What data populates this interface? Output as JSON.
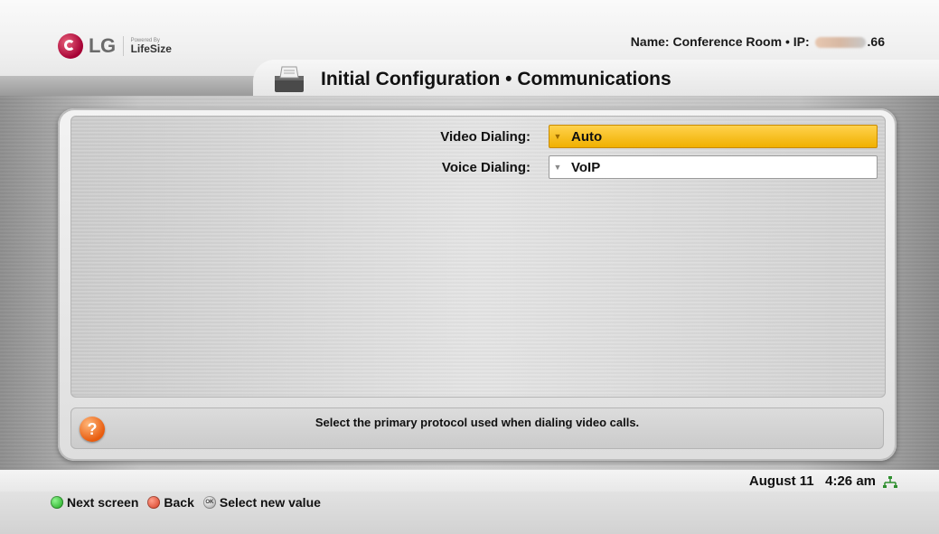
{
  "header": {
    "brand": "LG",
    "powered_by": "Powered By",
    "partner": "LifeSize",
    "name_label": "Name: Conference Room",
    "ip_label": "IP:",
    "ip_suffix": ".66",
    "separator": "•",
    "title": "Initial Configuration • Communications"
  },
  "fields": [
    {
      "label": "Video Dialing:",
      "value": "Auto",
      "focused": true
    },
    {
      "label": "Voice Dialing:",
      "value": "VoIP",
      "focused": false
    }
  ],
  "help": {
    "icon": "?",
    "text": "Select the primary protocol used when dialing video calls."
  },
  "status": {
    "date": "August 11",
    "time": "4:26 am",
    "network_icon": "network-icon"
  },
  "footer": {
    "items": [
      {
        "icon": "green-button",
        "label": "Next screen"
      },
      {
        "icon": "red-button",
        "label": "Back"
      },
      {
        "icon": "ok-button",
        "icon_text": "OK",
        "label": "Select new value"
      }
    ]
  },
  "colors": {
    "focus": "#f0b000",
    "lg_brand": "#a50034",
    "help_orange": "#e85c0e"
  }
}
